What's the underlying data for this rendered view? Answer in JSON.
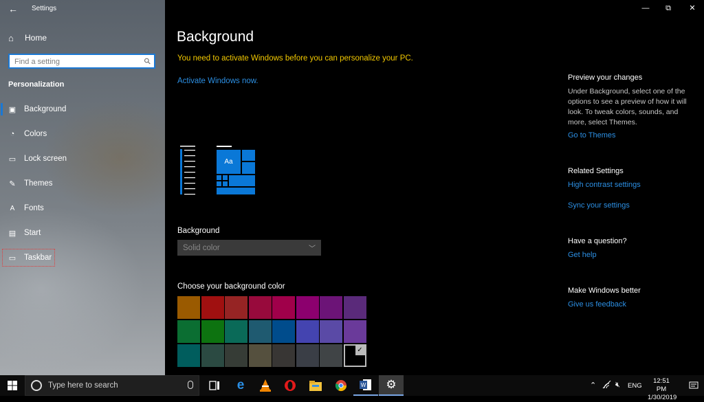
{
  "window": {
    "title": "Settings",
    "minimize": "—",
    "restore": "⧉",
    "close": "✕"
  },
  "sidebar": {
    "home": "Home",
    "search_placeholder": "Find a setting",
    "section": "Personalization",
    "items": [
      {
        "label": "Background",
        "icon": "picture-icon"
      },
      {
        "label": "Colors",
        "icon": "palette-icon"
      },
      {
        "label": "Lock screen",
        "icon": "lock-screen-icon"
      },
      {
        "label": "Themes",
        "icon": "brush-icon"
      },
      {
        "label": "Fonts",
        "icon": "fonts-icon"
      },
      {
        "label": "Start",
        "icon": "start-icon"
      },
      {
        "label": "Taskbar",
        "icon": "taskbar-icon"
      }
    ]
  },
  "main": {
    "title": "Background",
    "warning": "You need to activate Windows before you can personalize your PC.",
    "activate_link": "Activate Windows now.",
    "preview_tile_label": "Aa",
    "background_label": "Background",
    "dropdown_value": "Solid color",
    "choose_color_label": "Choose your background color",
    "swatches": [
      [
        "#9a5a00",
        "#a01010",
        "#962424",
        "#980a3c",
        "#a0004a",
        "#8c006e",
        "#6c1477",
        "#5a2a7a"
      ],
      [
        "#0b6e32",
        "#0d7310",
        "#0a6a58",
        "#1f5a70",
        "#004c8c",
        "#4444b0",
        "#5a4aa6",
        "#6a3a9a"
      ],
      [
        "#005d5d",
        "#2b4a42",
        "#363c36",
        "#55503e",
        "#383634",
        "#3a3e46",
        "#404446",
        "#000000"
      ]
    ],
    "selected_swatch": "#000000"
  },
  "right_pane": {
    "preview_title": "Preview your changes",
    "preview_text": "Under Background, select one of the options to see a preview of how it will look. To tweak colors, sounds, and more, select Themes.",
    "themes_link": "Go to Themes",
    "related_title": "Related Settings",
    "high_contrast_link": "High contrast settings",
    "sync_link": "Sync your settings",
    "question_title": "Have a question?",
    "help_link": "Get help",
    "better_title": "Make Windows better",
    "feedback_link": "Give us feedback"
  },
  "taskbar": {
    "search_placeholder": "Type here to search",
    "language": "ENG",
    "time": "12:51 PM",
    "date": "1/30/2019",
    "pinned": [
      "task-view-icon",
      "edge-icon",
      "vlc-icon",
      "opera-icon",
      "file-explorer-icon",
      "chrome-icon",
      "word-icon",
      "settings-icon"
    ]
  }
}
